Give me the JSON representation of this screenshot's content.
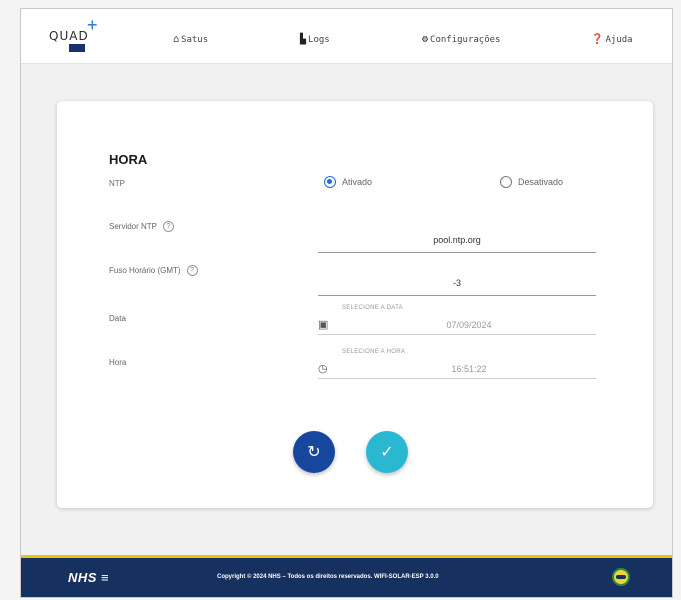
{
  "app": {
    "logo_text": "QUAD",
    "logo_star": "+",
    "logo_sub": "NHS"
  },
  "nav": [
    {
      "icon": "house-icon",
      "glyph": "⌂",
      "label": "Satus"
    },
    {
      "icon": "file-icon",
      "glyph": "▙",
      "label": "Logs"
    },
    {
      "icon": "gears-icon",
      "glyph": "⚙",
      "label": "Configurações"
    },
    {
      "icon": "help-circle-icon",
      "glyph": "❓",
      "label": "Ajuda"
    }
  ],
  "section": {
    "title": "HORA",
    "ntp_label": "NTP",
    "ntp_options": [
      "Ativado",
      "Desativado"
    ],
    "ntp_selected": "Ativado",
    "server_label": "Servidor NTP",
    "server_value": "pool.ntp.org",
    "tz_label": "Fuso Horário (GMT)",
    "tz_value": "-3",
    "date_label": "Data",
    "date_caption": "SELECIONE A DATA",
    "date_value": "07/09/2024",
    "time_label": "Hora",
    "time_caption": "SELECIONE A HORA",
    "time_value": "16:51:22",
    "help_glyph": "?"
  },
  "actions": {
    "reset_glyph": "↻",
    "confirm_glyph": "✓"
  },
  "footer": {
    "brand": "NHS ≡",
    "copyright": "Copyright © 2024 NHS – Todos os direitos reservados. WIFI-SOLAR-ESP 3.0.0"
  },
  "colors": {
    "primary": "#17479d",
    "accent": "#2ab7d1",
    "radio": "#1e6fd9",
    "footer": "#16305f",
    "footer_stripe": "#e5c21b"
  }
}
